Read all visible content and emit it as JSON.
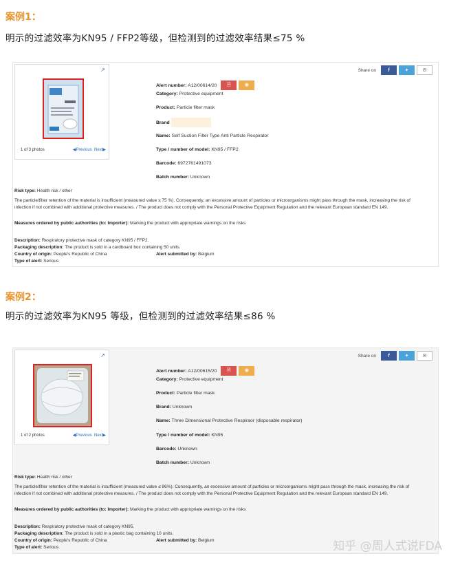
{
  "cases": [
    {
      "title": "案例1：",
      "desc": "明示的过滤效率为KN95 / FFP2等级，但检测到的过滤效率结果≤75 %",
      "share_label": "Share on",
      "alert_label": "Alert number:",
      "alert_value": "A12/00614/20",
      "category_label": "Category:",
      "category_value": "Protective equipment",
      "product_label": "Product:",
      "product_value": "Particle filter mask",
      "brand_label": "Brand",
      "brand_value": "",
      "name_label": "Name:",
      "name_value": "Self Suction Filter Type Anti Particle Respirator",
      "model_label": "Type / number of model:",
      "model_value": "KN95 / FFP2",
      "barcode_label": "Barcode:",
      "barcode_value": "6972761491073",
      "batch_label": "Batch number:",
      "batch_value": "Unknown",
      "photo_caption": "1 of 3 photos",
      "prev_label": "Previous",
      "next_label": "Next",
      "risk_label": "Risk type:",
      "risk_value": "Health risk / other",
      "risk_desc": "The particle/filter retention of the material is insufficient (measured value ≤ 75 %). Consequently, an excessive amount of particles or microorganisms might pass through the mask, increasing the risk of infection if not combined with additional protective measures. / The product does not comply with the Personal Protective Equipment Regulation and the relevant European standard EN 149.",
      "measures_label": "Measures ordered by public authorities (to: Importer):",
      "measures_value": "Marking the product with appropriate warnings on the risks",
      "description_label": "Description:",
      "description_value": "Respiratory protective mask of category KN95 / FFP2.",
      "packaging_label": "Packaging description:",
      "packaging_value": "The product is sold in a cardboard box containing 50 units.",
      "origin_label": "Country of origin:",
      "origin_value": "People's Republic of China",
      "submitted_label": "Alert submitted by:",
      "submitted_value": "Belgium",
      "alerttype_label": "Type of alert:",
      "alerttype_value": "Serious"
    },
    {
      "title": "案例2：",
      "desc": "明示的过滤效率为KN95 等级，但检测到的过滤效率结果≤86 %",
      "share_label": "Share on",
      "alert_label": "Alert number:",
      "alert_value": "A12/00615/20",
      "category_label": "Category:",
      "category_value": "Protective equipment",
      "product_label": "Product:",
      "product_value": "Particle filter mask",
      "brand_label": "Brand:",
      "brand_value": "Unknown",
      "name_label": "Name:",
      "name_value": "Three Dimensional Protective Respiraor (disposable respirator)",
      "model_label": "Type / number of model:",
      "model_value": "KN95",
      "barcode_label": "Barcode:",
      "barcode_value": "Unknown",
      "batch_label": "Batch number:",
      "batch_value": "Unknown",
      "photo_caption": "1 of 2 photos",
      "prev_label": "Previous",
      "next_label": "Next",
      "risk_label": "Risk type:",
      "risk_value": "Health risk / other",
      "risk_desc": "The particle/filter retention of the material is insufficient (measured value ≤ 86%). Consequently, an excessive amount of particles or microorganisms might pass through the mask, increasing the risk of infection if not combined with additional protective measures. / The product does not comply with the Personal Protective Equipment Regulation and the relevant European standard EN 149.",
      "measures_label": "Measures ordered by public authorities (to: Importer):",
      "measures_value": "Marking the product with appropriate warnings on the risks",
      "description_label": "Description:",
      "description_value": "Respiratory protective mask of category KN95.",
      "packaging_label": "Packaging description:",
      "packaging_value": "The product is sold in a plastic bag containing 10 units.",
      "origin_label": "Country of origin:",
      "origin_value": "People's Republic of China",
      "submitted_label": "Alert submitted by:",
      "submitted_value": "Belgium",
      "alerttype_label": "Type of alert:",
      "alerttype_value": "Serious"
    }
  ],
  "watermark": "知乎 @周人式说FDA"
}
